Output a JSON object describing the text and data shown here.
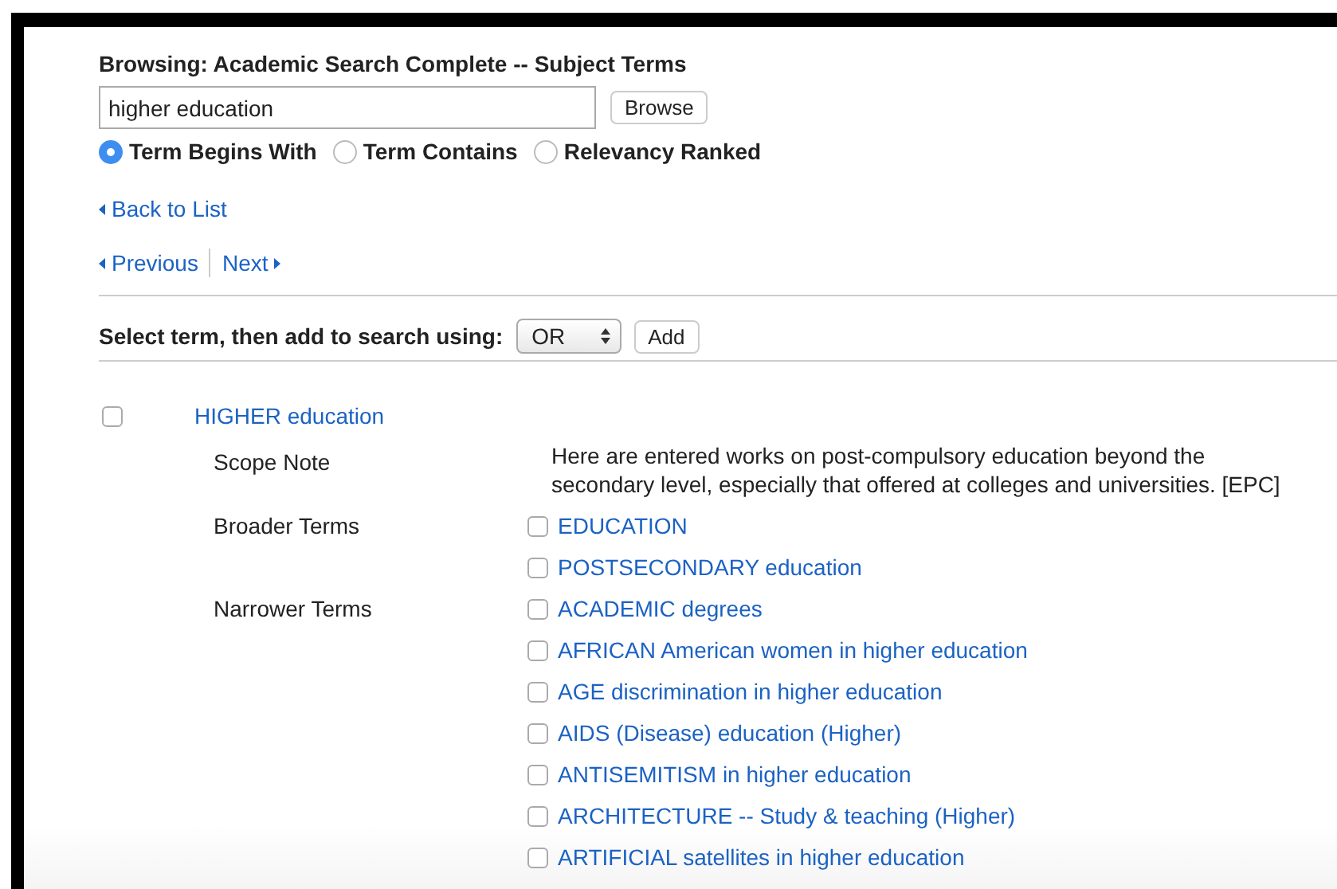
{
  "header": {
    "title": "Browsing: Academic Search Complete -- Subject Terms"
  },
  "search": {
    "value": "higher education",
    "button": "Browse"
  },
  "options": [
    {
      "label": "Term Begins With",
      "selected": true
    },
    {
      "label": "Term Contains",
      "selected": false
    },
    {
      "label": "Relevancy Ranked",
      "selected": false
    }
  ],
  "back_link": "Back to List",
  "pager": {
    "previous": "Previous",
    "next": "Next"
  },
  "add_bar": {
    "label": "Select term, then add to search using:",
    "operator": "OR",
    "button": "Add"
  },
  "term": {
    "label": "HIGHER education",
    "checked": false,
    "scope_note": {
      "label": "Scope Note",
      "text": "Here are entered works on post-compulsory education beyond the secondary level, especially that offered at colleges and universities. [EPC]"
    },
    "groups": [
      {
        "label": "Broader Terms",
        "terms": [
          {
            "label": "EDUCATION",
            "checked": false
          },
          {
            "label": "POSTSECONDARY education",
            "checked": false
          }
        ]
      },
      {
        "label": "Narrower Terms",
        "terms": [
          {
            "label": "ACADEMIC degrees",
            "checked": false
          },
          {
            "label": "AFRICAN American women in higher education",
            "checked": false
          },
          {
            "label": "AGE discrimination in higher education",
            "checked": false
          },
          {
            "label": "AIDS (Disease) education (Higher)",
            "checked": false
          },
          {
            "label": "ANTISEMITISM in higher education",
            "checked": false
          },
          {
            "label": "ARCHITECTURE -- Study & teaching (Higher)",
            "checked": false
          },
          {
            "label": "ARTIFICIAL satellites in higher education",
            "checked": false
          }
        ]
      }
    ]
  }
}
